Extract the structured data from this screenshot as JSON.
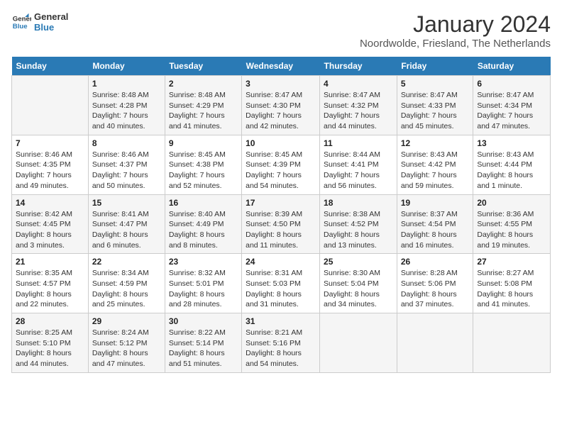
{
  "header": {
    "logo_line1": "General",
    "logo_line2": "Blue",
    "month": "January 2024",
    "location": "Noordwolde, Friesland, The Netherlands"
  },
  "days_of_week": [
    "Sunday",
    "Monday",
    "Tuesday",
    "Wednesday",
    "Thursday",
    "Friday",
    "Saturday"
  ],
  "weeks": [
    [
      {
        "day": "",
        "sunrise": "",
        "sunset": "",
        "daylight": ""
      },
      {
        "day": "1",
        "sunrise": "Sunrise: 8:48 AM",
        "sunset": "Sunset: 4:28 PM",
        "daylight": "Daylight: 7 hours and 40 minutes."
      },
      {
        "day": "2",
        "sunrise": "Sunrise: 8:48 AM",
        "sunset": "Sunset: 4:29 PM",
        "daylight": "Daylight: 7 hours and 41 minutes."
      },
      {
        "day": "3",
        "sunrise": "Sunrise: 8:47 AM",
        "sunset": "Sunset: 4:30 PM",
        "daylight": "Daylight: 7 hours and 42 minutes."
      },
      {
        "day": "4",
        "sunrise": "Sunrise: 8:47 AM",
        "sunset": "Sunset: 4:32 PM",
        "daylight": "Daylight: 7 hours and 44 minutes."
      },
      {
        "day": "5",
        "sunrise": "Sunrise: 8:47 AM",
        "sunset": "Sunset: 4:33 PM",
        "daylight": "Daylight: 7 hours and 45 minutes."
      },
      {
        "day": "6",
        "sunrise": "Sunrise: 8:47 AM",
        "sunset": "Sunset: 4:34 PM",
        "daylight": "Daylight: 7 hours and 47 minutes."
      }
    ],
    [
      {
        "day": "7",
        "sunrise": "Sunrise: 8:46 AM",
        "sunset": "Sunset: 4:35 PM",
        "daylight": "Daylight: 7 hours and 49 minutes."
      },
      {
        "day": "8",
        "sunrise": "Sunrise: 8:46 AM",
        "sunset": "Sunset: 4:37 PM",
        "daylight": "Daylight: 7 hours and 50 minutes."
      },
      {
        "day": "9",
        "sunrise": "Sunrise: 8:45 AM",
        "sunset": "Sunset: 4:38 PM",
        "daylight": "Daylight: 7 hours and 52 minutes."
      },
      {
        "day": "10",
        "sunrise": "Sunrise: 8:45 AM",
        "sunset": "Sunset: 4:39 PM",
        "daylight": "Daylight: 7 hours and 54 minutes."
      },
      {
        "day": "11",
        "sunrise": "Sunrise: 8:44 AM",
        "sunset": "Sunset: 4:41 PM",
        "daylight": "Daylight: 7 hours and 56 minutes."
      },
      {
        "day": "12",
        "sunrise": "Sunrise: 8:43 AM",
        "sunset": "Sunset: 4:42 PM",
        "daylight": "Daylight: 7 hours and 59 minutes."
      },
      {
        "day": "13",
        "sunrise": "Sunrise: 8:43 AM",
        "sunset": "Sunset: 4:44 PM",
        "daylight": "Daylight: 8 hours and 1 minute."
      }
    ],
    [
      {
        "day": "14",
        "sunrise": "Sunrise: 8:42 AM",
        "sunset": "Sunset: 4:45 PM",
        "daylight": "Daylight: 8 hours and 3 minutes."
      },
      {
        "day": "15",
        "sunrise": "Sunrise: 8:41 AM",
        "sunset": "Sunset: 4:47 PM",
        "daylight": "Daylight: 8 hours and 6 minutes."
      },
      {
        "day": "16",
        "sunrise": "Sunrise: 8:40 AM",
        "sunset": "Sunset: 4:49 PM",
        "daylight": "Daylight: 8 hours and 8 minutes."
      },
      {
        "day": "17",
        "sunrise": "Sunrise: 8:39 AM",
        "sunset": "Sunset: 4:50 PM",
        "daylight": "Daylight: 8 hours and 11 minutes."
      },
      {
        "day": "18",
        "sunrise": "Sunrise: 8:38 AM",
        "sunset": "Sunset: 4:52 PM",
        "daylight": "Daylight: 8 hours and 13 minutes."
      },
      {
        "day": "19",
        "sunrise": "Sunrise: 8:37 AM",
        "sunset": "Sunset: 4:54 PM",
        "daylight": "Daylight: 8 hours and 16 minutes."
      },
      {
        "day": "20",
        "sunrise": "Sunrise: 8:36 AM",
        "sunset": "Sunset: 4:55 PM",
        "daylight": "Daylight: 8 hours and 19 minutes."
      }
    ],
    [
      {
        "day": "21",
        "sunrise": "Sunrise: 8:35 AM",
        "sunset": "Sunset: 4:57 PM",
        "daylight": "Daylight: 8 hours and 22 minutes."
      },
      {
        "day": "22",
        "sunrise": "Sunrise: 8:34 AM",
        "sunset": "Sunset: 4:59 PM",
        "daylight": "Daylight: 8 hours and 25 minutes."
      },
      {
        "day": "23",
        "sunrise": "Sunrise: 8:32 AM",
        "sunset": "Sunset: 5:01 PM",
        "daylight": "Daylight: 8 hours and 28 minutes."
      },
      {
        "day": "24",
        "sunrise": "Sunrise: 8:31 AM",
        "sunset": "Sunset: 5:03 PM",
        "daylight": "Daylight: 8 hours and 31 minutes."
      },
      {
        "day": "25",
        "sunrise": "Sunrise: 8:30 AM",
        "sunset": "Sunset: 5:04 PM",
        "daylight": "Daylight: 8 hours and 34 minutes."
      },
      {
        "day": "26",
        "sunrise": "Sunrise: 8:28 AM",
        "sunset": "Sunset: 5:06 PM",
        "daylight": "Daylight: 8 hours and 37 minutes."
      },
      {
        "day": "27",
        "sunrise": "Sunrise: 8:27 AM",
        "sunset": "Sunset: 5:08 PM",
        "daylight": "Daylight: 8 hours and 41 minutes."
      }
    ],
    [
      {
        "day": "28",
        "sunrise": "Sunrise: 8:25 AM",
        "sunset": "Sunset: 5:10 PM",
        "daylight": "Daylight: 8 hours and 44 minutes."
      },
      {
        "day": "29",
        "sunrise": "Sunrise: 8:24 AM",
        "sunset": "Sunset: 5:12 PM",
        "daylight": "Daylight: 8 hours and 47 minutes."
      },
      {
        "day": "30",
        "sunrise": "Sunrise: 8:22 AM",
        "sunset": "Sunset: 5:14 PM",
        "daylight": "Daylight: 8 hours and 51 minutes."
      },
      {
        "day": "31",
        "sunrise": "Sunrise: 8:21 AM",
        "sunset": "Sunset: 5:16 PM",
        "daylight": "Daylight: 8 hours and 54 minutes."
      },
      {
        "day": "",
        "sunrise": "",
        "sunset": "",
        "daylight": ""
      },
      {
        "day": "",
        "sunrise": "",
        "sunset": "",
        "daylight": ""
      },
      {
        "day": "",
        "sunrise": "",
        "sunset": "",
        "daylight": ""
      }
    ]
  ]
}
